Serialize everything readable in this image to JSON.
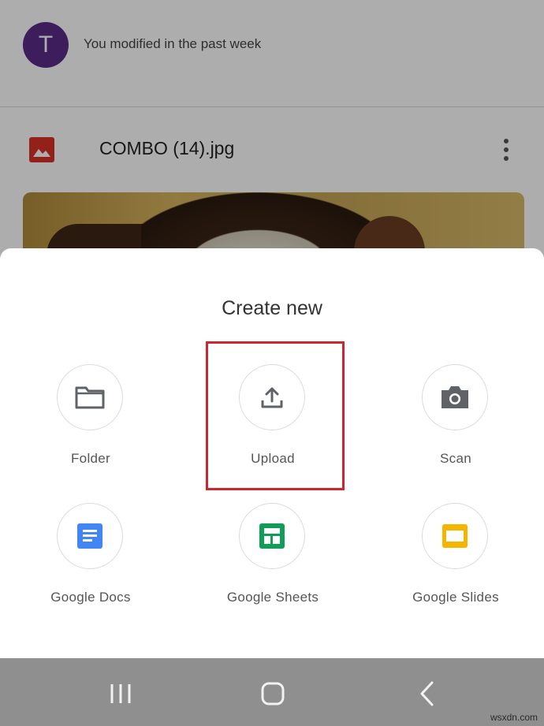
{
  "background": {
    "activity": {
      "avatar_letter": "T",
      "text": "You modified in the past week"
    },
    "file": {
      "icon": "image-file-icon",
      "name": "COMBO (14).jpg",
      "menu_icon": "more-vert-icon"
    }
  },
  "sheet": {
    "title": "Create new",
    "options": [
      {
        "label": "Folder",
        "icon": "folder-icon"
      },
      {
        "label": "Upload",
        "icon": "upload-icon"
      },
      {
        "label": "Scan",
        "icon": "camera-icon"
      },
      {
        "label": "Google Docs",
        "icon": "google-docs-icon",
        "color": "#4285f4"
      },
      {
        "label": "Google Sheets",
        "icon": "google-sheets-icon",
        "color": "#0f9d58"
      },
      {
        "label": "Google Slides",
        "icon": "google-slides-icon",
        "color": "#f4b400"
      }
    ],
    "highlight_color": "#d0242f"
  },
  "navbar": {
    "buttons": [
      "recents-icon",
      "home-icon",
      "back-icon"
    ]
  },
  "watermark": "wsxdn.com"
}
